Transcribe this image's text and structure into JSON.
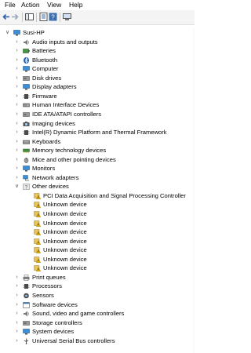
{
  "menu": [
    "File",
    "Action",
    "View",
    "Help"
  ],
  "colors": {
    "folder": "#e8c25c",
    "monitor": "#3c8fd6",
    "warning": "#e8b800",
    "bluetooth": "#1f5fb0"
  },
  "root": {
    "label": "Susi-HP",
    "icon": "computer-icon"
  },
  "categories_before": [
    {
      "label": "Audio inputs and outputs",
      "icon": "speaker-icon"
    },
    {
      "label": "Batteries",
      "icon": "battery-icon"
    },
    {
      "label": "Bluetooth",
      "icon": "bluetooth-icon"
    },
    {
      "label": "Computer",
      "icon": "monitor-icon"
    },
    {
      "label": "Disk drives",
      "icon": "disk-icon"
    },
    {
      "label": "Display adapters",
      "icon": "display-icon"
    },
    {
      "label": "Firmware",
      "icon": "chip-icon"
    },
    {
      "label": "Human Interface Devices",
      "icon": "hid-icon"
    },
    {
      "label": "IDE ATA/ATAPI controllers",
      "icon": "ide-icon"
    },
    {
      "label": "Imaging devices",
      "icon": "camera-icon"
    },
    {
      "label": "Intel(R) Dynamic Platform and Thermal Framework",
      "icon": "chip-icon"
    },
    {
      "label": "Keyboards",
      "icon": "keyboard-icon"
    },
    {
      "label": "Memory technology devices",
      "icon": "memory-icon"
    },
    {
      "label": "Mice and other pointing devices",
      "icon": "mouse-icon"
    },
    {
      "label": "Monitors",
      "icon": "monitor-icon"
    },
    {
      "label": "Network adapters",
      "icon": "network-icon"
    }
  ],
  "other_devices": {
    "label": "Other devices",
    "icon": "unknown-device-icon",
    "children": [
      "PCI Data Acquisition and Signal Processing Controller",
      "Unknown device",
      "Unknown device",
      "Unknown device",
      "Unknown device",
      "Unknown device",
      "Unknown device",
      "Unknown device",
      "Unknown device"
    ]
  },
  "categories_after": [
    {
      "label": "Print queues",
      "icon": "printer-icon"
    },
    {
      "label": "Processors",
      "icon": "cpu-icon"
    },
    {
      "label": "Sensors",
      "icon": "sensor-icon"
    },
    {
      "label": "Software devices",
      "icon": "software-icon"
    },
    {
      "label": "Sound, video and game controllers",
      "icon": "speaker-icon"
    },
    {
      "label": "Storage controllers",
      "icon": "storage-icon"
    },
    {
      "label": "System devices",
      "icon": "monitor-icon"
    },
    {
      "label": "Universal Serial Bus controllers",
      "icon": "usb-icon"
    }
  ]
}
